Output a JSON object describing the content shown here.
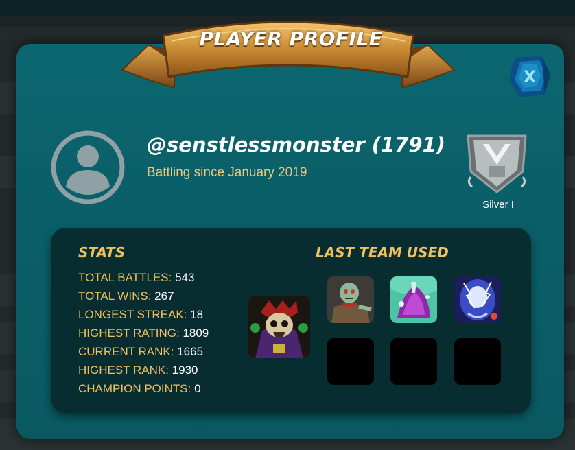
{
  "modal": {
    "title": "PLAYER PROFILE",
    "close_label": "X"
  },
  "player": {
    "username_display": "@senstlessmonster (1791)",
    "since": "Battling since January 2019",
    "league": "Silver I"
  },
  "stats": {
    "heading": "STATS",
    "rows": [
      {
        "label": "TOTAL BATTLES:",
        "value": "543"
      },
      {
        "label": "TOTAL WINS:",
        "value": "267"
      },
      {
        "label": "LONGEST STREAK:",
        "value": "18"
      },
      {
        "label": "HIGHEST RATING:",
        "value": "1809"
      },
      {
        "label": "CURRENT RANK:",
        "value": "1665"
      },
      {
        "label": "HIGHEST RANK:",
        "value": "1930"
      },
      {
        "label": "CHAMPION POINTS:",
        "value": "0"
      }
    ]
  },
  "team": {
    "heading": "LAST TEAM USED",
    "summoner_icon": "death-summoner-icon",
    "monster_icons": [
      "zombie-monster-icon",
      "purple-spirit-monster-icon",
      "lightning-spirit-monster-icon",
      "empty-slot",
      "empty-slot",
      "empty-slot"
    ]
  },
  "colors": {
    "modal_bg": "#0a6069",
    "accent_gold": "#f0c060",
    "stats_bg": "#082d31"
  }
}
